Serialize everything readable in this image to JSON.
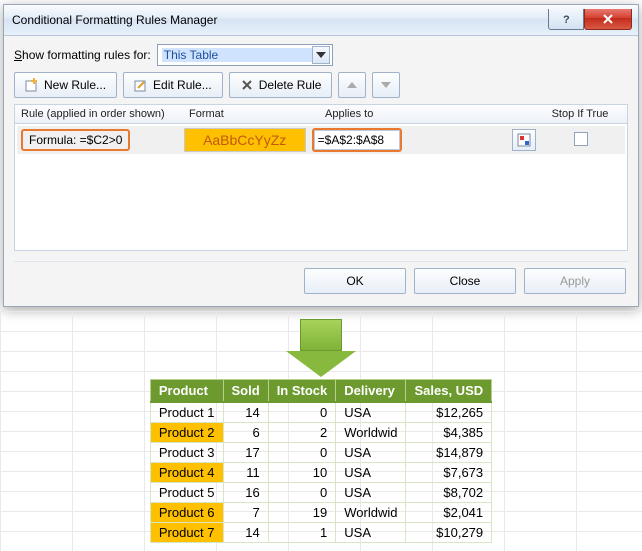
{
  "dialog": {
    "title": "Conditional Formatting Rules Manager",
    "show_label_pre": "S",
    "show_label_post": "how formatting rules for:",
    "scope_value": "This Table",
    "buttons": {
      "new": "New Rule...",
      "edit": "Edit Rule...",
      "delete": "Delete Rule"
    },
    "headers": {
      "rule": "Rule (applied in order shown)",
      "format": "Format",
      "applies": "Applies to",
      "stop": "Stop If True"
    },
    "rule": {
      "desc": "Formula: =$C2>0",
      "preview": "AaBbCcYyZz",
      "applies_to": "=$A$2:$A$8"
    },
    "footer": {
      "ok": "OK",
      "close": "Close",
      "apply": "Apply"
    }
  },
  "table": {
    "headers": [
      "Product",
      "Sold",
      "In Stock",
      "Delivery",
      "Sales,  USD"
    ],
    "rows": [
      {
        "product": "Product 1",
        "sold": "14",
        "stock": "0",
        "delivery": "USA",
        "sales": "$12,265",
        "hl": false
      },
      {
        "product": "Product 2",
        "sold": "6",
        "stock": "2",
        "delivery": "Worldwid",
        "sales": "$4,385",
        "hl": true
      },
      {
        "product": "Product 3",
        "sold": "17",
        "stock": "0",
        "delivery": "USA",
        "sales": "$14,879",
        "hl": false
      },
      {
        "product": "Product 4",
        "sold": "11",
        "stock": "10",
        "delivery": "USA",
        "sales": "$7,673",
        "hl": true
      },
      {
        "product": "Product 5",
        "sold": "16",
        "stock": "0",
        "delivery": "USA",
        "sales": "$8,702",
        "hl": false
      },
      {
        "product": "Product 6",
        "sold": "7",
        "stock": "19",
        "delivery": "Worldwid",
        "sales": "$2,041",
        "hl": true
      },
      {
        "product": "Product 7",
        "sold": "14",
        "stock": "1",
        "delivery": "USA",
        "sales": "$10,279",
        "hl": true
      }
    ]
  }
}
